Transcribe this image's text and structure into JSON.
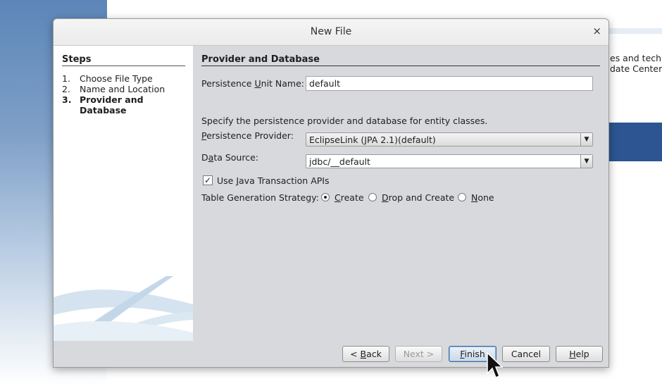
{
  "background": {
    "text_lines": [
      "es and techr",
      "date Center."
    ]
  },
  "dialog": {
    "title": "New File",
    "close_glyph": "×"
  },
  "steps": {
    "title": "Steps",
    "items": [
      {
        "num": "1.",
        "label": "Choose File Type",
        "current": false
      },
      {
        "num": "2.",
        "label": "Name and Location",
        "current": false
      },
      {
        "num": "3.",
        "label": "Provider and Database",
        "current": true
      }
    ]
  },
  "panel": {
    "section_title": "Provider and Database",
    "unit_name_label": {
      "pre": "Persistence ",
      "mn": "U",
      "post": "nit Name:"
    },
    "unit_name_value": "default",
    "description": "Specify the persistence provider and database for entity classes.",
    "provider_label": {
      "pre": "",
      "mn": "P",
      "post": "ersistence Provider:"
    },
    "provider_value": "EclipseLink (JPA 2.1)(default)",
    "datasource_label": {
      "pre": "D",
      "mn": "a",
      "post": "ta Source:"
    },
    "datasource_value": "jdbc/__default",
    "jta_checkbox": {
      "checked": true,
      "label_pre": "Use ",
      "mn": "J",
      "label_post": "ava Transaction APIs"
    },
    "strategy_label": "Table Generation Strategy:",
    "strategy_options": [
      {
        "pre": "",
        "mn": "C",
        "post": "reate",
        "selected": true
      },
      {
        "pre": "",
        "mn": "D",
        "post": "rop and Create",
        "selected": false
      },
      {
        "pre": "",
        "mn": "N",
        "post": "one",
        "selected": false
      }
    ],
    "combo_arrow": "▼"
  },
  "buttons": {
    "back": {
      "pre": "< ",
      "mn": "B",
      "post": "ack"
    },
    "next": {
      "pre": "Next >",
      "mn": "",
      "post": ""
    },
    "finish": {
      "pre": "",
      "mn": "F",
      "post": "inish"
    },
    "cancel": {
      "pre": "Cancel",
      "mn": "",
      "post": ""
    },
    "help": {
      "pre": "",
      "mn": "H",
      "post": "elp"
    }
  }
}
